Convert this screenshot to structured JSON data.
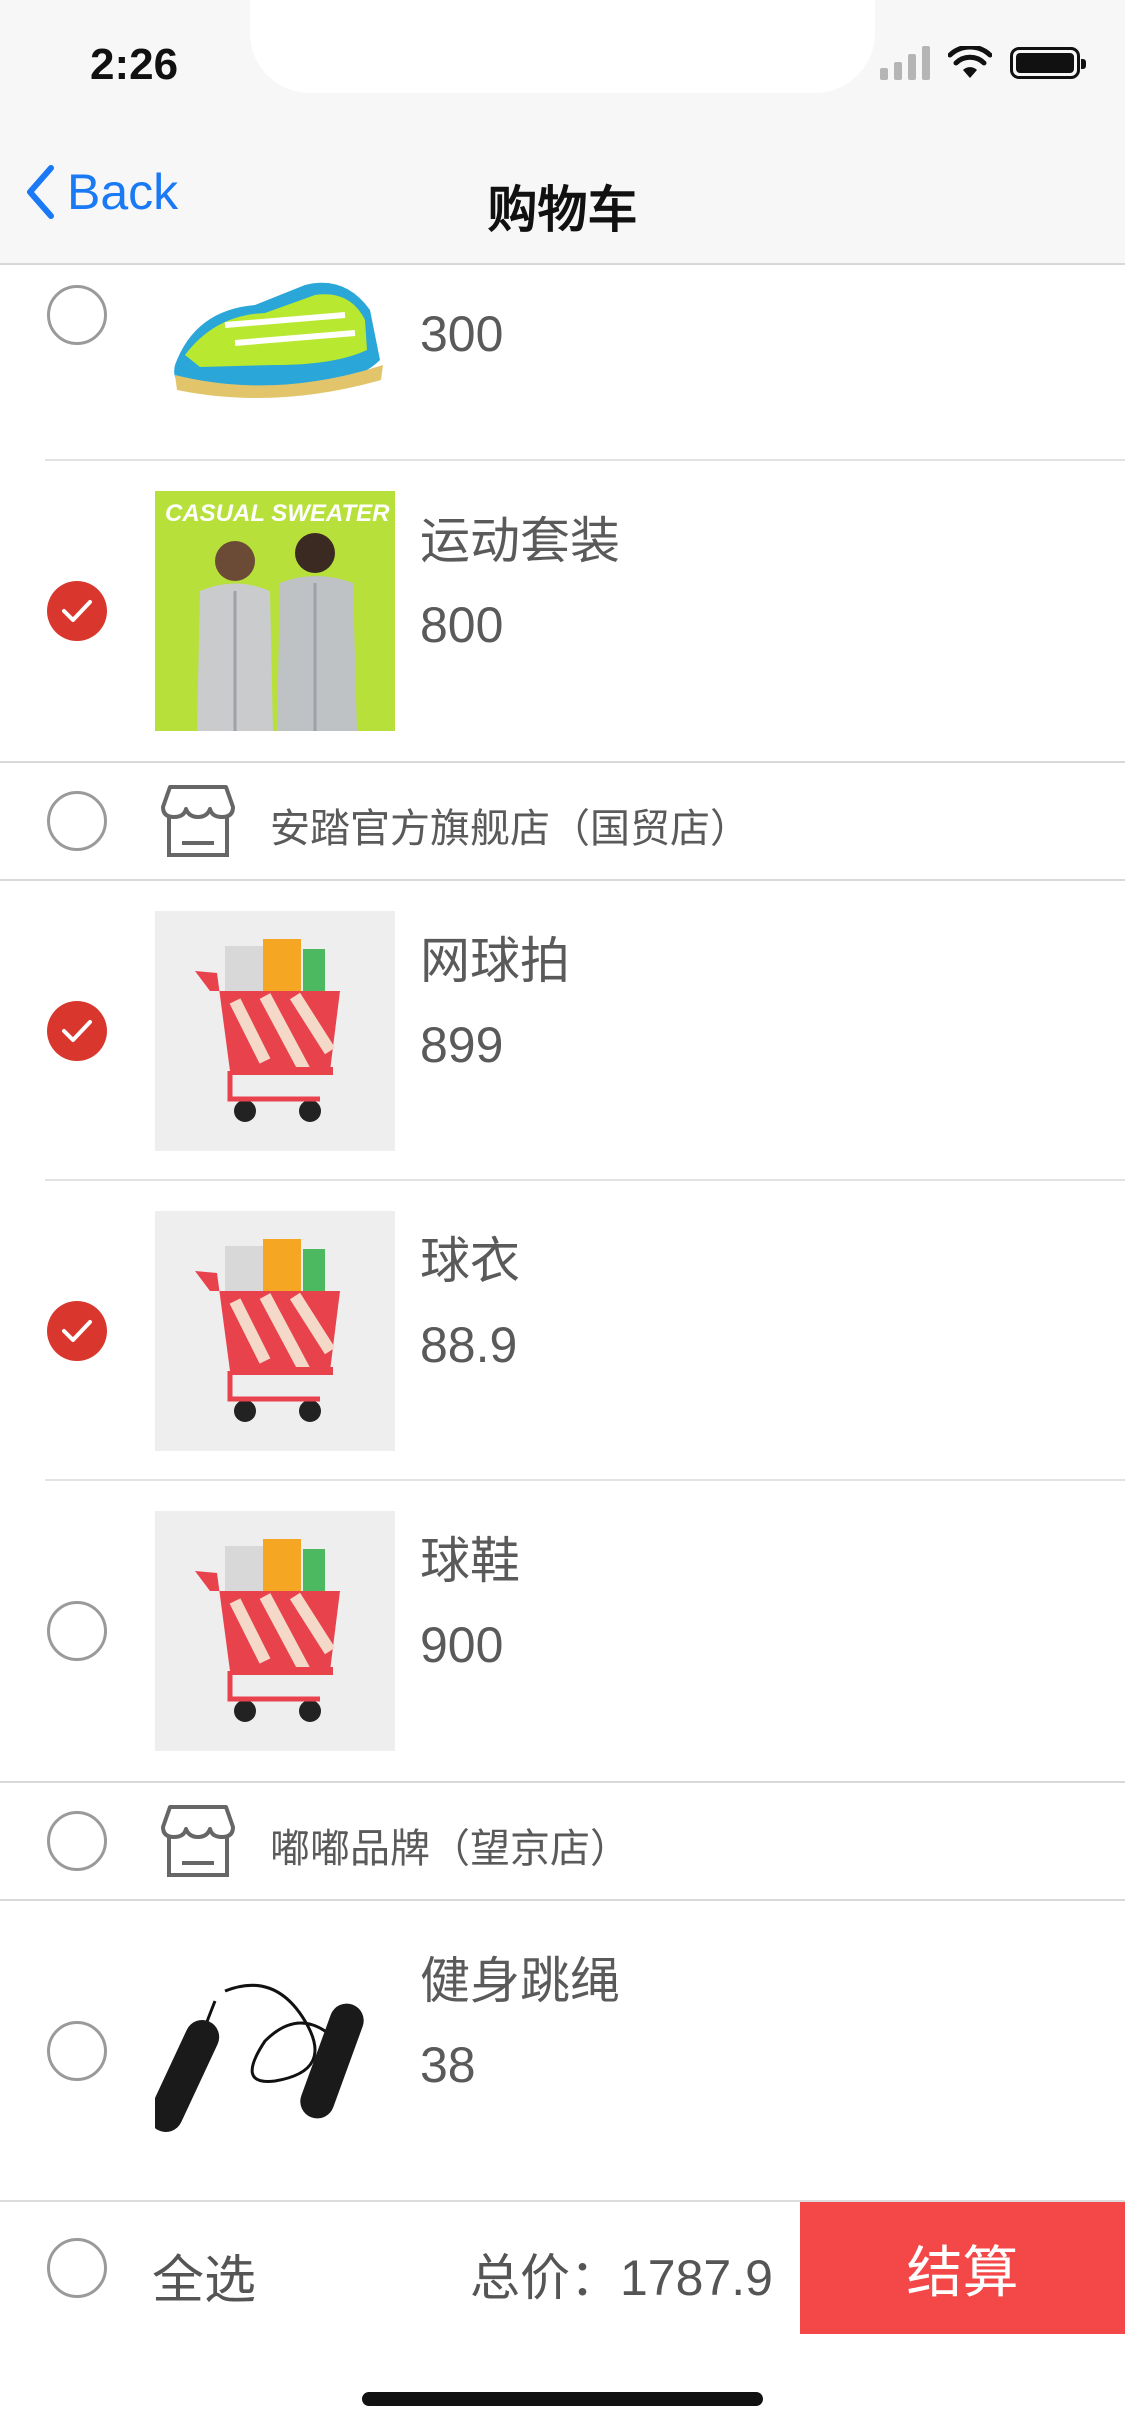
{
  "status_bar": {
    "time": "2:26"
  },
  "nav": {
    "back_label": "Back",
    "title": "购物车"
  },
  "items": [
    {
      "name": "",
      "price": "300",
      "checked": false,
      "image": "sneaker-photo"
    },
    {
      "name": "运动套装",
      "price": "800",
      "checked": true,
      "image": "tracksuit-photo",
      "image_text": "CASUAL SWEATER"
    },
    {
      "shop": "安踏官方旗舰店（国贸店）",
      "checked": false
    },
    {
      "name": "网球拍",
      "price": "899",
      "checked": true,
      "image": "cart-placeholder"
    },
    {
      "name": "球衣",
      "price": "88.9",
      "checked": true,
      "image": "cart-placeholder"
    },
    {
      "name": "球鞋",
      "price": "900",
      "checked": false,
      "image": "cart-placeholder"
    },
    {
      "shop": "嘟嘟品牌（望京店）",
      "checked": false
    },
    {
      "name": "健身跳绳",
      "price": "38",
      "checked": false,
      "image": "jump-rope-photo"
    }
  ],
  "footer": {
    "select_all_label": "全选",
    "total_label": "总价：",
    "total_value": "1787.9",
    "checkout_label": "结算"
  },
  "colors": {
    "accent": "#d9372e",
    "checkout": "#f44848",
    "link": "#1a7af6"
  }
}
